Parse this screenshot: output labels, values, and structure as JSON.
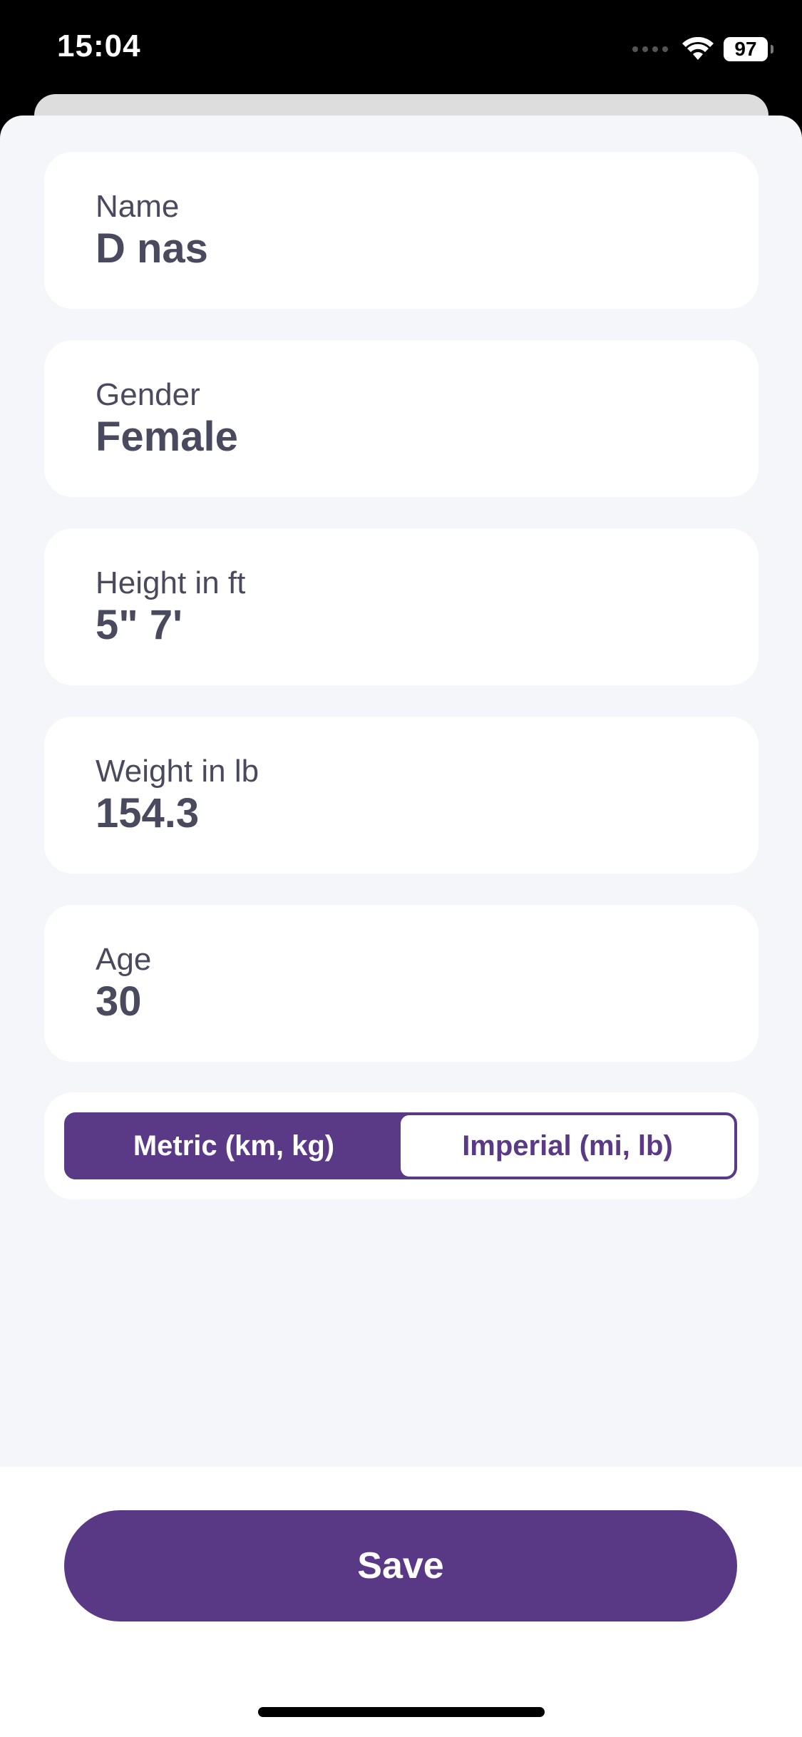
{
  "status_bar": {
    "time": "15:04",
    "battery": "97"
  },
  "profile": {
    "fields": [
      {
        "label": "Name",
        "value": "D nas"
      },
      {
        "label": "Gender",
        "value": "Female"
      },
      {
        "label": "Height in ft",
        "value": "5\" 7'"
      },
      {
        "label": "Weight in lb",
        "value": "154.3"
      },
      {
        "label": "Age",
        "value": "30"
      }
    ]
  },
  "units": {
    "metric_label": "Metric (km, kg)",
    "imperial_label": "Imperial (mi, lb)",
    "selected": "imperial"
  },
  "actions": {
    "save_label": "Save"
  },
  "colors": {
    "accent": "#593985",
    "background": "#f5f6fa",
    "text": "#4a4a5e"
  }
}
